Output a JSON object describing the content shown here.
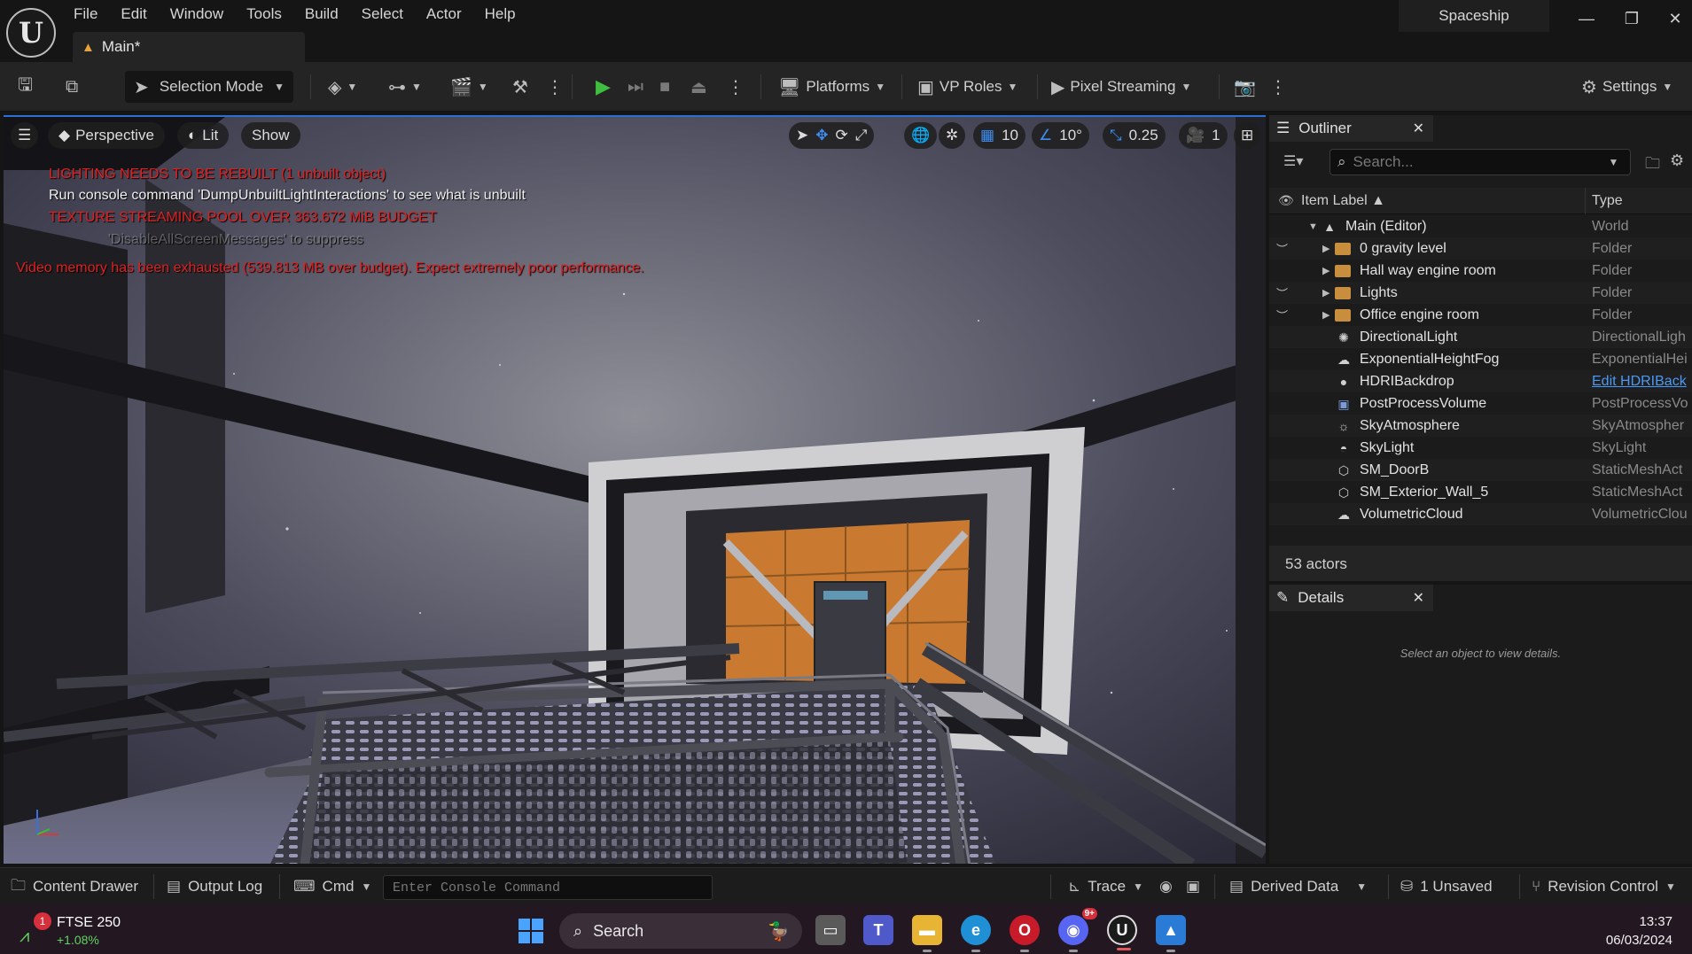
{
  "menu": [
    "File",
    "Edit",
    "Window",
    "Tools",
    "Build",
    "Select",
    "Actor",
    "Help"
  ],
  "document_tab": {
    "label": "Main*"
  },
  "project_name": "Spaceship",
  "toolbar": {
    "selection_mode": "Selection Mode",
    "platforms": "Platforms",
    "vp_roles": "VP Roles",
    "pixel_streaming": "Pixel Streaming",
    "settings": "Settings"
  },
  "viewport": {
    "perspective": "Perspective",
    "lit": "Lit",
    "show": "Show",
    "grid_snap": "10",
    "angle_snap": "10°",
    "scale_snap": "0.25",
    "camera_speed": "1",
    "messages": {
      "lighting": "LIGHTING NEEDS TO BE REBUILT (1 unbuilt object)",
      "console_hint": "Run console command 'DumpUnbuiltLightInteractions' to see what is unbuilt",
      "texture_pool": "TEXTURE STREAMING POOL OVER 363.672 MiB BUDGET",
      "suppress": "'DisableAllScreenMessages' to suppress",
      "video_memory": "Video memory has been exhausted (539.813 MB over budget). Expect extremely poor performance."
    }
  },
  "outliner": {
    "title": "Outliner",
    "search_placeholder": "Search...",
    "col_label": "Item Label",
    "col_type": "Type",
    "rows": [
      {
        "label": "Main (Editor)",
        "type": "World"
      },
      {
        "label": "0 gravity level",
        "type": "Folder"
      },
      {
        "label": "Hall way engine room",
        "type": "Folder"
      },
      {
        "label": "Lights",
        "type": "Folder"
      },
      {
        "label": "Office engine room",
        "type": "Folder"
      },
      {
        "label": "DirectionalLight",
        "type": "DirectionalLigh"
      },
      {
        "label": "ExponentialHeightFog",
        "type": "ExponentialHei"
      },
      {
        "label": "HDRIBackdrop",
        "type": "Edit HDRIBack"
      },
      {
        "label": "PostProcessVolume",
        "type": "PostProcessVo"
      },
      {
        "label": "SkyAtmosphere",
        "type": "SkyAtmospher"
      },
      {
        "label": "SkyLight",
        "type": "SkyLight"
      },
      {
        "label": "SM_DoorB",
        "type": "StaticMeshAct"
      },
      {
        "label": "SM_Exterior_Wall_5",
        "type": "StaticMeshAct"
      },
      {
        "label": "VolumetricCloud",
        "type": "VolumetricClou"
      }
    ],
    "actors": "53 actors"
  },
  "details": {
    "title": "Details",
    "empty": "Select an object to view details."
  },
  "statusbar": {
    "content_drawer": "Content Drawer",
    "output_log": "Output Log",
    "cmd": "Cmd",
    "console_placeholder": "Enter Console Command",
    "trace": "Trace",
    "derived_data": "Derived Data",
    "unsaved": "1 Unsaved",
    "revision_control": "Revision Control"
  },
  "taskbar": {
    "stock_name": "FTSE 250",
    "stock_change": "+1.08%",
    "stock_badge": "1",
    "search": "Search",
    "discord_badge": "9+",
    "time": "13:37",
    "date": "06/03/2024"
  }
}
